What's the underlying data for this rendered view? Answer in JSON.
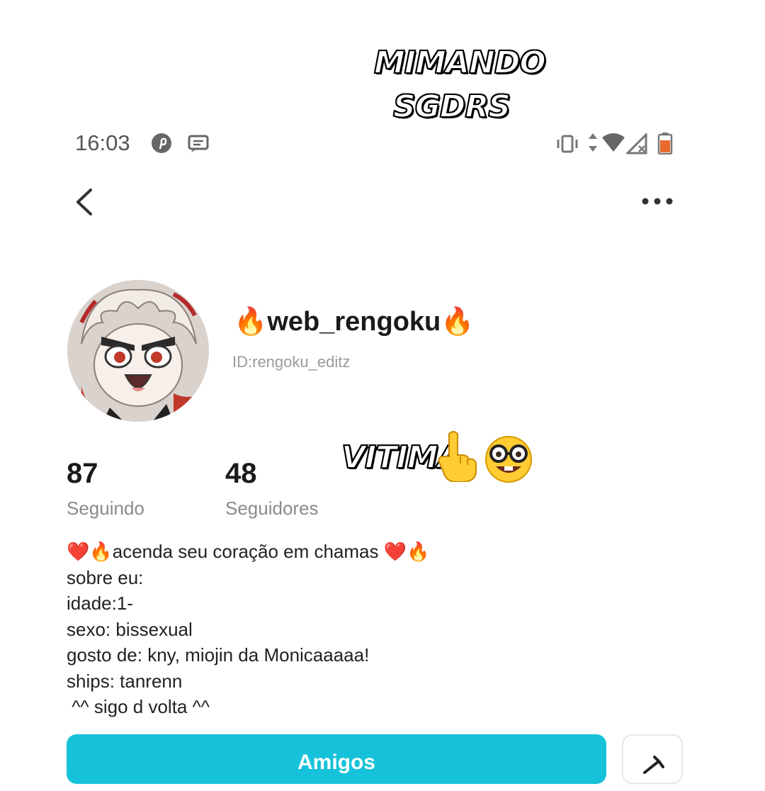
{
  "overlay": {
    "caption_line1": "MIMANDO",
    "caption_line2": "SGDRS",
    "caption_victim": "VITIMA",
    "emoji_point_icon": "index-pointing-up-emoji",
    "emoji_nerd_icon": "nerd-face-emoji"
  },
  "status_bar": {
    "time": "16:03",
    "icons": [
      "pinterest-icon",
      "message-icon",
      "vibrate-icon",
      "data-arrows-icon",
      "wifi-icon",
      "signal-icon",
      "battery-icon"
    ],
    "battery_color": "#e86a2c"
  },
  "header": {
    "back_icon": "chevron-left-icon",
    "more_icon": "more-horizontal-icon"
  },
  "profile": {
    "username": "🔥web_rengoku🔥",
    "id": "ID:rengoku_editz",
    "following_count": "87",
    "following_label": "Seguindo",
    "followers_count": "48",
    "followers_label": "Seguidores",
    "bio": "❤️🔥acenda seu coração em chamas ❤️🔥\nsobre eu:\nidade:1-\nsexo: bissexual\ngosto de: kny, miojin da Monicaaaaa!\nships: tanrenn\n ^^ sigo d volta ^^"
  },
  "actions": {
    "friends_label": "Amigos",
    "share_icon": "share-icon",
    "accent_color": "#16c2d9"
  }
}
